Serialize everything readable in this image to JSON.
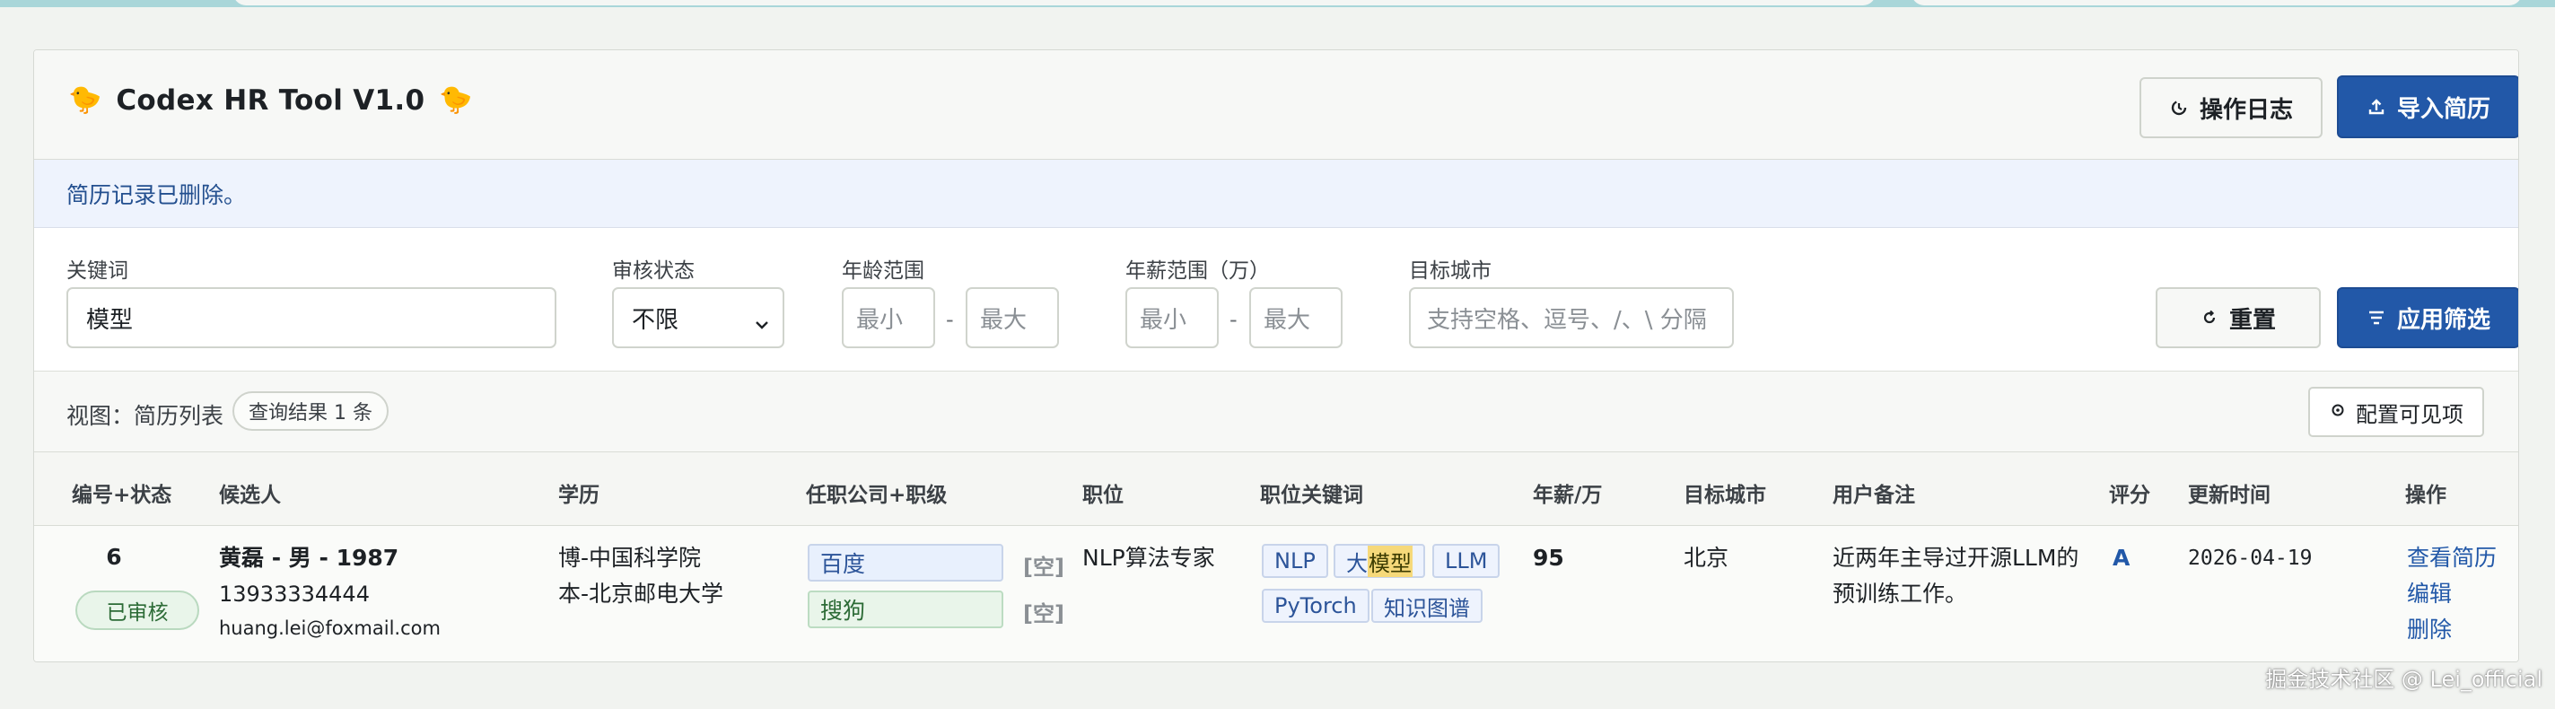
{
  "app": {
    "title": "Codex HR Tool V1.0",
    "title_emoji": "🐤",
    "log_button": "操作日志",
    "import_button": "导入简历"
  },
  "alert": {
    "message": "简历记录已删除。"
  },
  "filters": {
    "keyword_label": "关键词",
    "keyword_value": "模型",
    "status_label": "审核状态",
    "status_value": "不限",
    "age_label": "年龄范围",
    "age_min_placeholder": "最小",
    "age_max_placeholder": "最大",
    "salary_label": "年薪范围（万）",
    "salary_min_placeholder": "最小",
    "salary_max_placeholder": "最大",
    "city_label": "目标城市",
    "city_placeholder": "支持空格、逗号、/、\\ 分隔",
    "range_separator": "-",
    "reset_button": "重置",
    "apply_button": "应用筛选"
  },
  "view": {
    "label": "视图：简历列表",
    "count": "查询结果 1 条",
    "config_button": "配置可见项"
  },
  "table": {
    "headers": [
      "编号+状态",
      "候选人",
      "学历",
      "任职公司+职级",
      "职位",
      "职位关键词",
      "年薪/万",
      "目标城市",
      "用户备注",
      "评分",
      "更新时间",
      "操作"
    ],
    "rows": [
      {
        "id": "6",
        "status": "已审核",
        "name": "黄磊 - 男 - 1987",
        "phone": "13933334444",
        "email": "huang.lei@foxmail.com",
        "education": [
          "博-中国科学院",
          "本-北京邮电大学"
        ],
        "companies": [
          {
            "name": "百度",
            "level": "[空]",
            "color": "#e8f0fd"
          },
          {
            "name": "搜狗",
            "level": "[空]",
            "color": "#e9f5ea"
          }
        ],
        "position": "NLP算法专家",
        "keywords": [
          "NLP",
          "大模型",
          "LLM",
          "PyTorch",
          "知识图谱"
        ],
        "keyword_highlight": "模型",
        "salary": "95",
        "city": "北京",
        "note_line1": "近两年主导过开源LLM的",
        "note_line2": "预训练工作。",
        "rating": "A",
        "updated": "2026-04-19",
        "actions": [
          "查看简历",
          "编辑",
          "删除"
        ]
      }
    ]
  },
  "watermark": "掘金技术社区 @ Lei_official"
}
